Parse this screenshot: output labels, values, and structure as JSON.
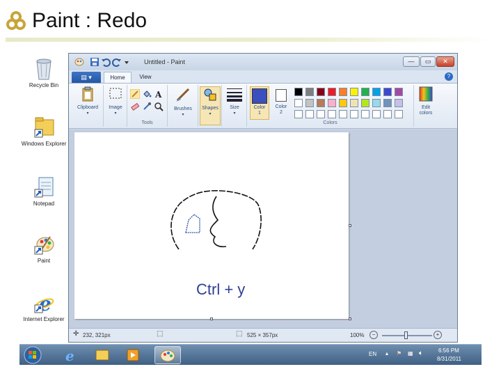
{
  "slide": {
    "title": "Paint : Redo"
  },
  "desktop": {
    "icons": [
      {
        "label": "Recycle Bin"
      },
      {
        "label": "Windows Explorer"
      },
      {
        "label": "Notepad"
      },
      {
        "label": "Paint"
      },
      {
        "label": "Internet Explorer"
      }
    ]
  },
  "window": {
    "title": "Untitled - Paint",
    "controls": {
      "minimize": "—",
      "maximize": "▭",
      "close": "✕"
    }
  },
  "ribbon": {
    "file_tab": "▤ ▾",
    "tabs": [
      "Home",
      "View"
    ],
    "help": "?",
    "clipboard": "Clipboard",
    "image": "Image",
    "tools_group": "Tools",
    "brushes": "Brushes",
    "shapes": "Shapes",
    "size": "Size",
    "color1": "Color\n1",
    "color2": "Color\n2",
    "colors_group": "Colors",
    "edit_colors": "Edit\ncolors",
    "color1_value": "#3c4fbf",
    "color2_value": "#ffffff",
    "palette_row1": [
      "#000000",
      "#7f7f7f",
      "#880015",
      "#ed1c24",
      "#ff7f27",
      "#fff200",
      "#22b14c",
      "#00a2e8",
      "#3f48cc",
      "#a349a4"
    ],
    "palette_row2": [
      "#ffffff",
      "#c3c3c3",
      "#b97a57",
      "#ffaec9",
      "#ffc90e",
      "#efe4b0",
      "#b5e61d",
      "#99d9ea",
      "#7092be",
      "#c8bfe7"
    ],
    "palette_row3": [
      "#ffffff",
      "#ffffff",
      "#ffffff",
      "#ffffff",
      "#ffffff",
      "#ffffff",
      "#ffffff",
      "#ffffff",
      "#ffffff",
      "#ffffff"
    ]
  },
  "canvas": {
    "caption": "Ctrl + y"
  },
  "status": {
    "cursor": "232, 321px",
    "dimensions": "525 × 357px",
    "zoom": "100%"
  },
  "taskbar": {
    "language": "EN",
    "time": "6:56 PM",
    "date": "8/31/2011"
  }
}
